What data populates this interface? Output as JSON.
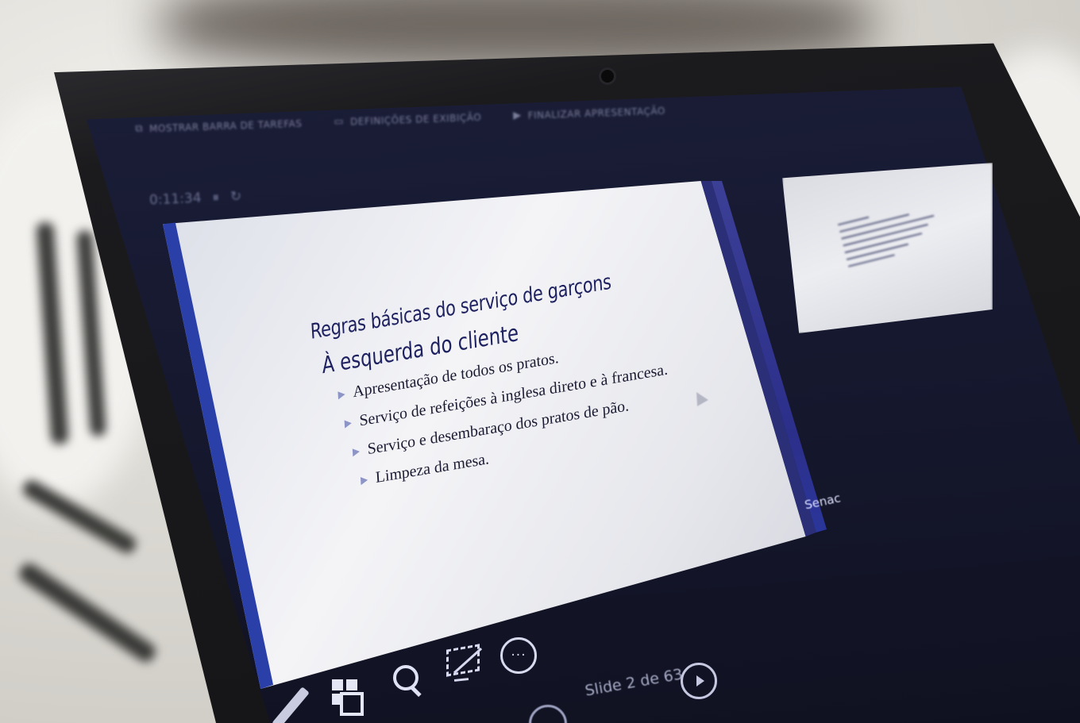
{
  "toolbar": {
    "taskbar_label": "MOSTRAR BARRA DE TAREFAS",
    "display_label": "DEFINIÇÕES DE EXIBIÇÃO",
    "end_label": "FINALIZAR APRESENTAÇÃO"
  },
  "timer": {
    "elapsed": "0:11:34",
    "pause_glyph": "⏸",
    "reset_glyph": "↻"
  },
  "slide": {
    "title": "Regras básicas do serviço de garçons",
    "subtitle": "À esquerda do cliente",
    "bullets": [
      "Apresentação de todos os pratos.",
      "Serviço de refeições à inglesa direto e à francesa.",
      "Serviço e desembaraço dos pratos de pão.",
      "Limpeza da mesa."
    ],
    "logo_text": "Senac"
  },
  "controls": {
    "more_glyph": "···",
    "slide_counter": "Slide 2 de 63"
  },
  "icons": {
    "pen": "pen-icon",
    "all_slides": "slides-grid-icon",
    "zoom": "zoom-icon",
    "black_screen": "black-screen-icon",
    "more": "more-options-icon",
    "previous": "previous-icon",
    "next": "next-icon"
  },
  "colors": {
    "screen_bg": "#15172d",
    "slide_accent": "#2b3fa8",
    "slide_text": "#1e2160"
  }
}
